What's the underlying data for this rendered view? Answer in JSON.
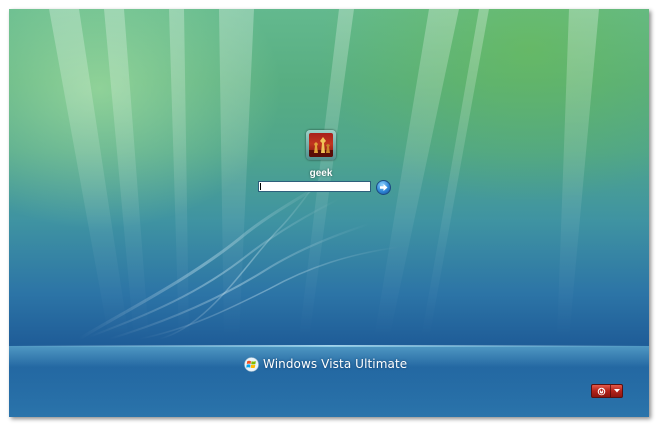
{
  "login": {
    "username": "geek",
    "password_value": ""
  },
  "footer": {
    "brand_text": "Windows Vista Ultimate"
  },
  "icons": {
    "avatar": "chess-pieces-avatar",
    "submit": "arrow-right-icon",
    "brand": "windows-flag-icon",
    "power": "power-icon",
    "power_menu": "chevron-down-icon"
  },
  "colors": {
    "background_top": "#63b98e",
    "background_bottom": "#1f5d98",
    "power_button": "#b3221a",
    "go_button": "#2e86d6",
    "text": "#ffffff"
  }
}
